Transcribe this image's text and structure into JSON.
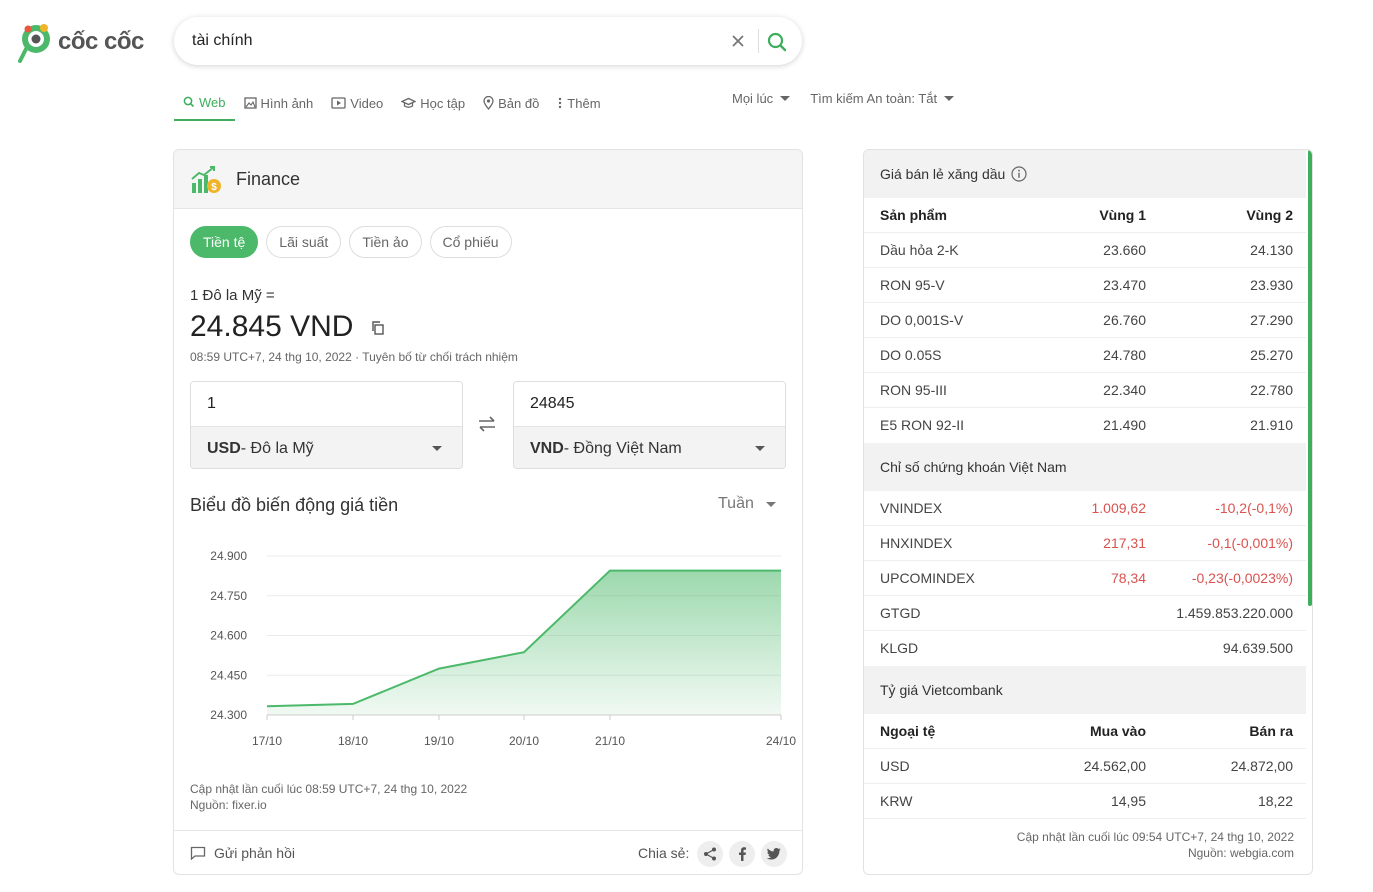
{
  "header": {
    "logo_text": "cốc cốc",
    "search_value": "tài chính"
  },
  "tabs": [
    {
      "label": "Web",
      "icon": "search-icon"
    },
    {
      "label": "Hình ảnh",
      "icon": "image-icon"
    },
    {
      "label": "Video",
      "icon": "video-icon"
    },
    {
      "label": "Học tập",
      "icon": "graduation-cap-icon"
    },
    {
      "label": "Bản đồ",
      "icon": "map-pin-icon"
    },
    {
      "label": "Thêm",
      "icon": "more-icon"
    }
  ],
  "filters": {
    "time": "Mọi lúc",
    "safe": "Tìm kiếm An toàn: Tắt"
  },
  "finance": {
    "title": "Finance",
    "pills": [
      "Tiền tệ",
      "Lãi suất",
      "Tiền ảo",
      "Cổ phiếu"
    ],
    "rate_label": "1 Đô la Mỹ =",
    "rate_value": "24.845 VND",
    "rate_meta": "08:59 UTC+7, 24 thg 10, 2022 · Tuyên bố từ chối trách nhiệm",
    "from_amount": "1",
    "from_code": "USD",
    "from_name": " - Đô la Mỹ",
    "to_amount": "24845",
    "to_code": "VND",
    "to_name": " - Đồng Việt Nam",
    "chart_title": "Biểu đồ biến động giá tiền",
    "period": "Tuần",
    "chart_meta_1": "Cập nhật lần cuối lúc 08:59 UTC+7, 24 thg 10, 2022",
    "chart_meta_2": "Nguồn: fixer.io",
    "feedback": "Gửi phản hồi",
    "share_label": "Chia sẻ:"
  },
  "chart_data": {
    "type": "area",
    "x": [
      "17/10",
      "18/10",
      "19/10",
      "20/10",
      "21/10",
      "24/10"
    ],
    "values": [
      24333,
      24342,
      24475,
      24537,
      24845,
      24845
    ],
    "y_ticks": [
      "24.900",
      "24.750",
      "24.600",
      "24.450",
      "24.300"
    ],
    "ylim": [
      24300,
      24900
    ],
    "color": "#4cb96a",
    "grid": true
  },
  "fuel": {
    "title": "Giá bán lẻ xăng dầu",
    "headers": [
      "Sản phẩm",
      "Vùng 1",
      "Vùng 2"
    ],
    "rows": [
      [
        "Dầu hỏa 2-K",
        "23.660",
        "24.130"
      ],
      [
        "RON 95-V",
        "23.470",
        "23.930"
      ],
      [
        "DO 0,001S-V",
        "26.760",
        "27.290"
      ],
      [
        "DO 0.05S",
        "24.780",
        "25.270"
      ],
      [
        "RON 95-III",
        "22.340",
        "22.780"
      ],
      [
        "E5 RON 92-II",
        "21.490",
        "21.910"
      ]
    ]
  },
  "stocks": {
    "title": "Chỉ số chứng khoán Việt Nam",
    "rows": [
      [
        "VNINDEX",
        "1.009,62",
        "-10,2(-0,1%)"
      ],
      [
        "HNXINDEX",
        "217,31",
        "-0,1(-0,001%)"
      ],
      [
        "UPCOMINDEX",
        "78,34",
        "-0,23(-0,0023%)"
      ],
      [
        "GTGD",
        "",
        "1.459.853.220.000"
      ],
      [
        "KLGD",
        "",
        "94.639.500"
      ]
    ],
    "down_color": "#d9534f"
  },
  "fx": {
    "title": "Tỷ giá Vietcombank",
    "headers": [
      "Ngoại tệ",
      "Mua vào",
      "Bán ra"
    ],
    "rows": [
      [
        "USD",
        "24.562,00",
        "24.872,00"
      ],
      [
        "KRW",
        "14,95",
        "18,22"
      ]
    ],
    "meta_1": "Cập nhật lần cuối lúc 09:54 UTC+7, 24 thg 10, 2022",
    "meta_2": "Nguồn: webgia.com"
  }
}
